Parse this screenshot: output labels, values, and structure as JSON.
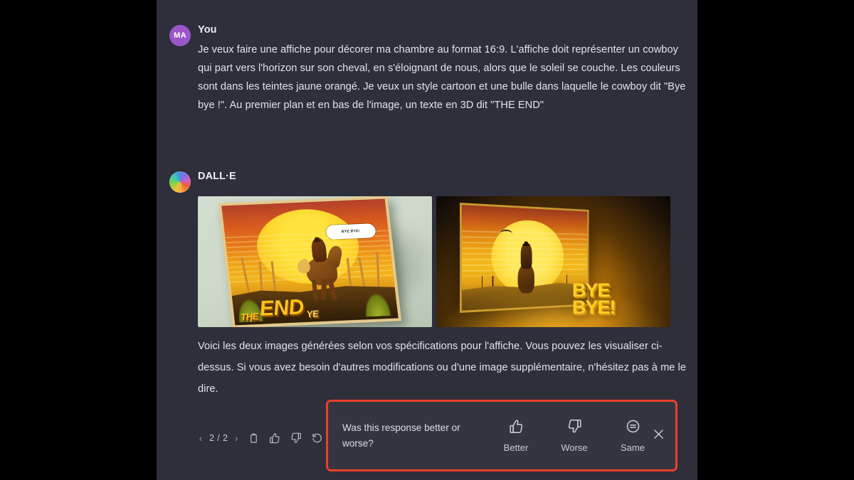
{
  "window": {
    "background_color": "#000000",
    "panel_color": "#2e2f3a"
  },
  "user_message": {
    "avatar_initials": "MA",
    "avatar_color": "#9a56c9",
    "author": "You",
    "text": "Je veux faire une affiche pour décorer ma chambre au format 16:9. L'affiche doit représenter un cowboy qui part vers l'horizon sur son cheval, en s'éloignant de nous, alors que le soleil se couche. Les couleurs sont dans les teintes jaune orangé. Je veux un style cartoon et une bulle dans laquelle le cowboy dit \"Bye bye !\". Au premier plan et en bas de l'image, un texte en 3D dit \"THE END\""
  },
  "assistant_message": {
    "avatar_icon": "dalle-logo-icon",
    "author": "DALL·E",
    "images": [
      {
        "name": "generated-image-1",
        "description": "Poster mockup tilted against a mint green wall: cartoon cowboy riding a horse toward a large yellow setting sun, wooden fence, speech bubble, and 3D THE END text at the bottom.",
        "poster_text_the": "THE",
        "poster_text_end": "END",
        "poster_text_ye": "YE",
        "speech_bubble": "BYE BYE!"
      },
      {
        "name": "generated-image-2",
        "description": "3D billboard glowing in an amber room showing a cowboy silhouette riding into a huge yellow sun, with large 3D BYE BYE! lettering standing in front of it.",
        "text_line_1": "BYE",
        "text_line_2": "BYE!"
      }
    ],
    "text": "Voici les deux images générées selon vos spécifications pour l'affiche. Vous pouvez les visualiser ci-dessus. Si vous avez besoin d'autres modifications ou d'une image supplémentaire, n'hésitez pas à me le dire."
  },
  "action_toolbar": {
    "prev_label": "‹",
    "page_counter": "2 / 2",
    "next_label": "›",
    "buttons": [
      {
        "name": "copy-button",
        "icon": "copy-icon"
      },
      {
        "name": "thumbs-up-button",
        "icon": "thumbs-up-icon"
      },
      {
        "name": "thumbs-down-button",
        "icon": "thumbs-down-icon"
      },
      {
        "name": "regenerate-button",
        "icon": "regenerate-icon"
      }
    ]
  },
  "feedback_panel": {
    "border_color": "#e8402a",
    "background_color": "#343541",
    "question": "Was this response better or worse?",
    "options": [
      {
        "name": "better",
        "label": "Better",
        "icon": "thumbs-up-icon"
      },
      {
        "name": "worse",
        "label": "Worse",
        "icon": "thumbs-down-icon"
      },
      {
        "name": "same",
        "label": "Same",
        "icon": "equals-circle-icon"
      }
    ],
    "close_icon": "close-icon"
  }
}
